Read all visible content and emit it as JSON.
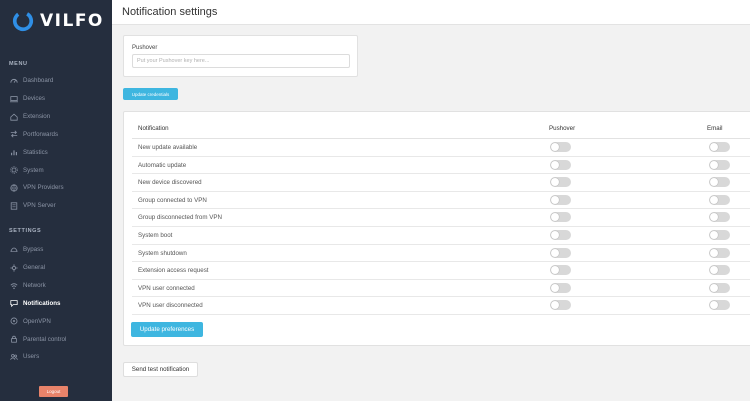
{
  "brand": {
    "name": "VILFO"
  },
  "colors": {
    "sidebar_bg": "#252e3e",
    "accent_blue": "#3eb6e0",
    "logout": "#e8836a",
    "logo_blue": "#2f8fe6"
  },
  "sidebar": {
    "menu_label": "MENU",
    "menu_items": [
      {
        "label": "Dashboard",
        "icon": "dashboard-icon"
      },
      {
        "label": "Devices",
        "icon": "devices-icon"
      },
      {
        "label": "Extension",
        "icon": "extension-icon"
      },
      {
        "label": "Portforwards",
        "icon": "portforwards-icon"
      },
      {
        "label": "Statistics",
        "icon": "statistics-icon"
      },
      {
        "label": "System",
        "icon": "system-icon"
      },
      {
        "label": "VPN Providers",
        "icon": "vpn-providers-icon"
      },
      {
        "label": "VPN Server",
        "icon": "vpn-server-icon"
      }
    ],
    "settings_label": "SETTINGS",
    "settings_items": [
      {
        "label": "Bypass",
        "icon": "bypass-icon"
      },
      {
        "label": "General",
        "icon": "general-icon"
      },
      {
        "label": "Network",
        "icon": "network-icon"
      },
      {
        "label": "Notifications",
        "icon": "notifications-icon",
        "active": true
      },
      {
        "label": "OpenVPN",
        "icon": "openvpn-icon"
      },
      {
        "label": "Parental control",
        "icon": "parental-control-icon"
      },
      {
        "label": "Users",
        "icon": "users-icon"
      }
    ],
    "logout_label": "Logout"
  },
  "page": {
    "title": "Notification settings"
  },
  "pushover": {
    "label": "Pushover",
    "placeholder": "Put your Pushover key here...",
    "value": "",
    "update_button": "Update credentials"
  },
  "notifications": {
    "headers": {
      "notification": "Notification",
      "pushover": "Pushover",
      "email": "Email"
    },
    "rows": [
      {
        "label": "New update available",
        "pushover": false,
        "email": false
      },
      {
        "label": "Automatic update",
        "pushover": false,
        "email": false
      },
      {
        "label": "New device discovered",
        "pushover": false,
        "email": false
      },
      {
        "label": "Group connected to VPN",
        "pushover": false,
        "email": false
      },
      {
        "label": "Group disconnected from VPN",
        "pushover": false,
        "email": false
      },
      {
        "label": "System boot",
        "pushover": false,
        "email": false
      },
      {
        "label": "System shutdown",
        "pushover": false,
        "email": false
      },
      {
        "label": "Extension access request",
        "pushover": false,
        "email": false
      },
      {
        "label": "VPN user connected",
        "pushover": false,
        "email": false
      },
      {
        "label": "VPN user disconnected",
        "pushover": false,
        "email": false
      }
    ],
    "update_button": "Update preferences"
  },
  "test_button": "Send test notification"
}
